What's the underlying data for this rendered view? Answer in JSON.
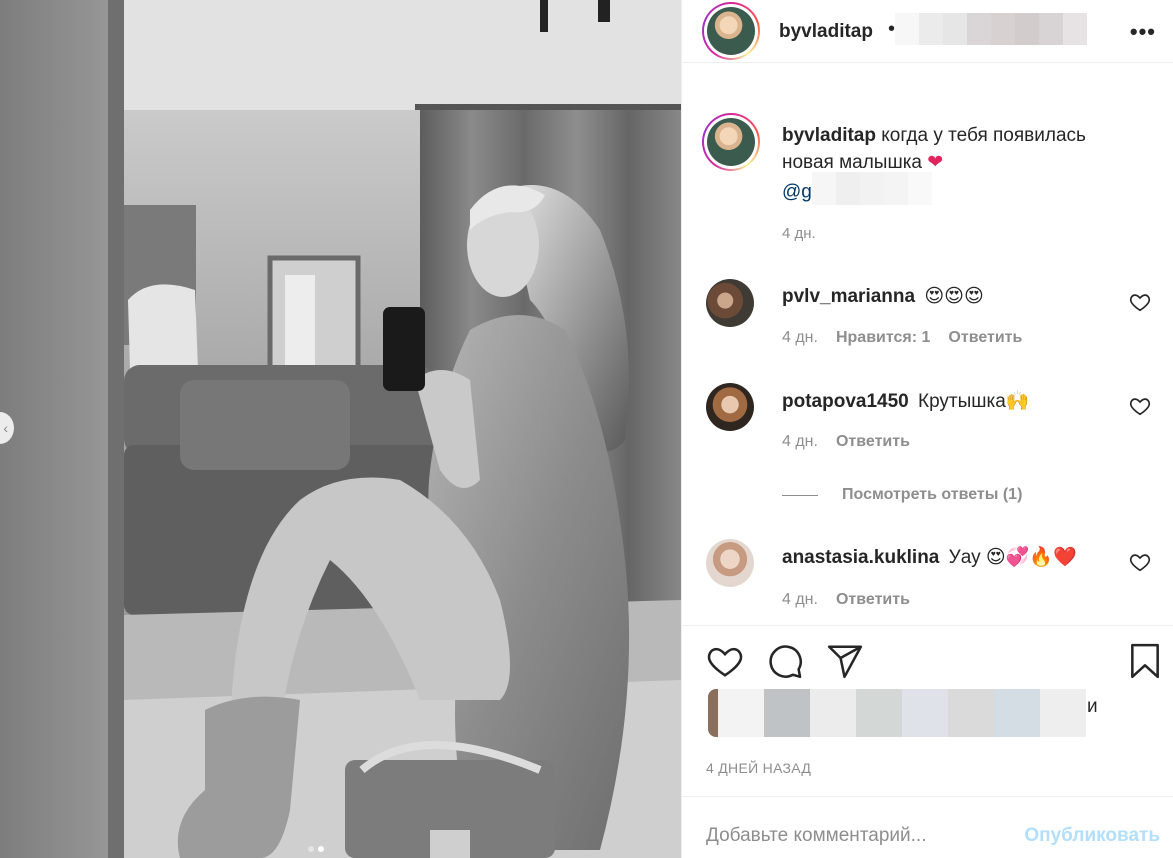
{
  "post": {
    "author": "byvladitap",
    "separator": "•",
    "more_label": "•••"
  },
  "caption": {
    "username": "byvladitap",
    "text": "когда у тебя появилась новая малышка",
    "emoji": "❤",
    "mention_prefix": "@g",
    "time": "4 дн."
  },
  "comments": [
    {
      "username": "pvlv_marianna",
      "text": "😍😍😍",
      "time": "4 дн.",
      "likes_label": "Нравится: 1",
      "reply_label": "Ответить"
    },
    {
      "username": "potapova1450",
      "text": "Крутышка🙌",
      "time": "4 дн.",
      "reply_label": "Ответить"
    },
    {
      "username": "anastasia.kuklina",
      "text": "Уау 😍💞🔥❤️",
      "time": "4 дн.",
      "reply_label": "Ответить"
    }
  ],
  "view_replies_label": "Посмотреть ответы (1)",
  "likes_trailing": "и",
  "date": "4 ДНЕЙ НАЗАД",
  "comment_box": {
    "placeholder": "Добавьте комментарий...",
    "publish_label": "Опубликовать"
  },
  "carousel": {
    "count": 2,
    "active_index": 1
  },
  "icons": [
    "heart-icon",
    "comment-icon",
    "share-icon",
    "bookmark-icon",
    "chevron-left-icon"
  ],
  "colors": {
    "link": "#00376b",
    "muted": "#8e8e8e",
    "publish_disabled": "#b2dffc",
    "text": "#262626"
  }
}
